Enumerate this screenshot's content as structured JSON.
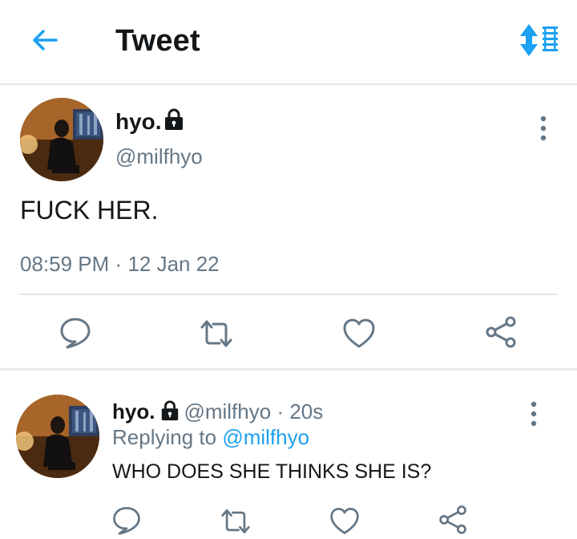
{
  "header": {
    "title": "Tweet",
    "back_icon": "arrow-left-icon",
    "sort_icon": "sort-icon",
    "accent": "#1da1f2"
  },
  "tweet": {
    "display_name": "hyo.",
    "handle": "@milfhyo",
    "protected_icon": "lock-icon",
    "text": "FUCK HER.",
    "time": "08:59 PM",
    "separator": "·",
    "date": "12 Jan 22",
    "actions": [
      "reply-icon",
      "retweet-icon",
      "like-icon",
      "share-icon"
    ]
  },
  "reply": {
    "display_name": "hyo.",
    "handle": "@milfhyo",
    "separator": "·",
    "time": "20s",
    "replying_prefix": "Replying to",
    "replying_to": "@milfhyo",
    "text": "WHO DOES SHE THINKS SHE IS?",
    "actions": [
      "reply-icon",
      "retweet-icon",
      "like-icon",
      "share-icon"
    ]
  },
  "colors": {
    "text": "#14171a",
    "secondary": "#657786",
    "link": "#1da1f2",
    "divider": "#e1e8ed"
  }
}
